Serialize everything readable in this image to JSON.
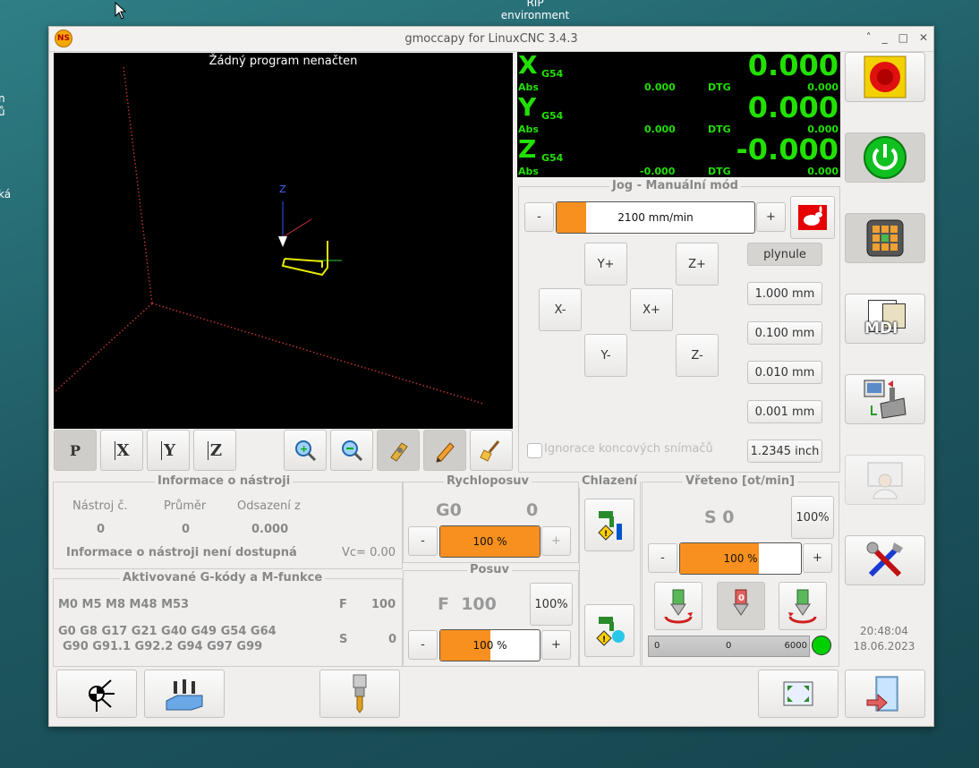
{
  "desktop": {
    "label_line1": "RIP",
    "label_line2": "environment",
    "edge1": "n",
    "edge2": "ů",
    "edge3": "ká"
  },
  "window": {
    "title": "gmoccapy for LinuxCNC  3.4.3",
    "min": "˄",
    "iconify": "_",
    "maximize": "□",
    "close": "✕"
  },
  "preview": {
    "message": "Žádný program nenačten",
    "axis_z": "Z"
  },
  "view_buttons": [
    "P",
    "X",
    "Y",
    "Z"
  ],
  "dro": {
    "axes": [
      {
        "name": "X",
        "cs": "G54",
        "value": "0.000",
        "abs_label": "Abs",
        "abs": "0.000",
        "dtg_label": "DTG",
        "dtg": "0.000"
      },
      {
        "name": "Y",
        "cs": "G54",
        "value": "0.000",
        "abs_label": "Abs",
        "abs": "0.000",
        "dtg_label": "DTG",
        "dtg": "0.000"
      },
      {
        "name": "Z",
        "cs": "G54",
        "value": "-0.000",
        "abs_label": "Abs",
        "abs": "-0.000",
        "dtg_label": "DTG",
        "dtg": "0.000"
      }
    ]
  },
  "jog": {
    "title": "Jog - Manuální mód",
    "minus": "-",
    "plus": "+",
    "speed": "2100 mm/min",
    "speed_fraction": 0.15,
    "keys": {
      "yplus": "Y+",
      "zplus": "Z+",
      "xminus": "X-",
      "xplus": "X+",
      "yminus": "Y-",
      "zminus": "Z-"
    },
    "increments": [
      "plynule",
      "1.000 mm",
      "0.100 mm",
      "0.010 mm",
      "0.001 mm"
    ],
    "ignore_limits": "Ignorace koncových snímačů",
    "unit_button": "1.2345 inch"
  },
  "tool": {
    "title": "Informace o nástroji",
    "headers": [
      "Nástroj č.",
      "Průměr",
      "Odsazení z"
    ],
    "values": [
      "0",
      "0",
      "0.000"
    ],
    "note": "Informace o nástroji není dostupná",
    "vc": "Vc= 0.00"
  },
  "rapid": {
    "title": "Rychloposuv",
    "gcode": "G0",
    "value": "0",
    "minus": "-",
    "plus": "+",
    "percent": "100 %",
    "fraction": 1.0
  },
  "feed": {
    "title": "Posuv",
    "label": "F  100",
    "reset": "100%",
    "minus": "-",
    "plus": "+",
    "percent": "100 %",
    "fraction": 0.5
  },
  "cool": {
    "title": "Chlazení"
  },
  "spindle": {
    "title": "Vřeteno [ot/min]",
    "speed": "S 0",
    "reset": "100%",
    "minus": "-",
    "plus": "+",
    "percent": "100 %",
    "fraction": 0.65,
    "bar_min": "0",
    "bar_val": "0",
    "bar_max": "6000",
    "led_color": "#00d000"
  },
  "gcodes": {
    "title": "Aktivované G-kódy a M-funkce",
    "mcodes": "M0 M5 M8 M48 M53",
    "f_label": "F",
    "f_value": "100",
    "g_line1": "G0 G8 G17 G21 G40 G49 G54 G64",
    "g_line2": "G90 G91.1 G92.2 G94 G97 G99",
    "s_label": "S",
    "s_value": "0"
  },
  "sidebar": {
    "mdi_label": "MDI"
  },
  "clock": {
    "time": "20:48:04",
    "date": "18.06.2023"
  },
  "colors": {
    "accent": "#f7901e",
    "dro_text": "#22e000",
    "preview_bg": "#000000"
  }
}
